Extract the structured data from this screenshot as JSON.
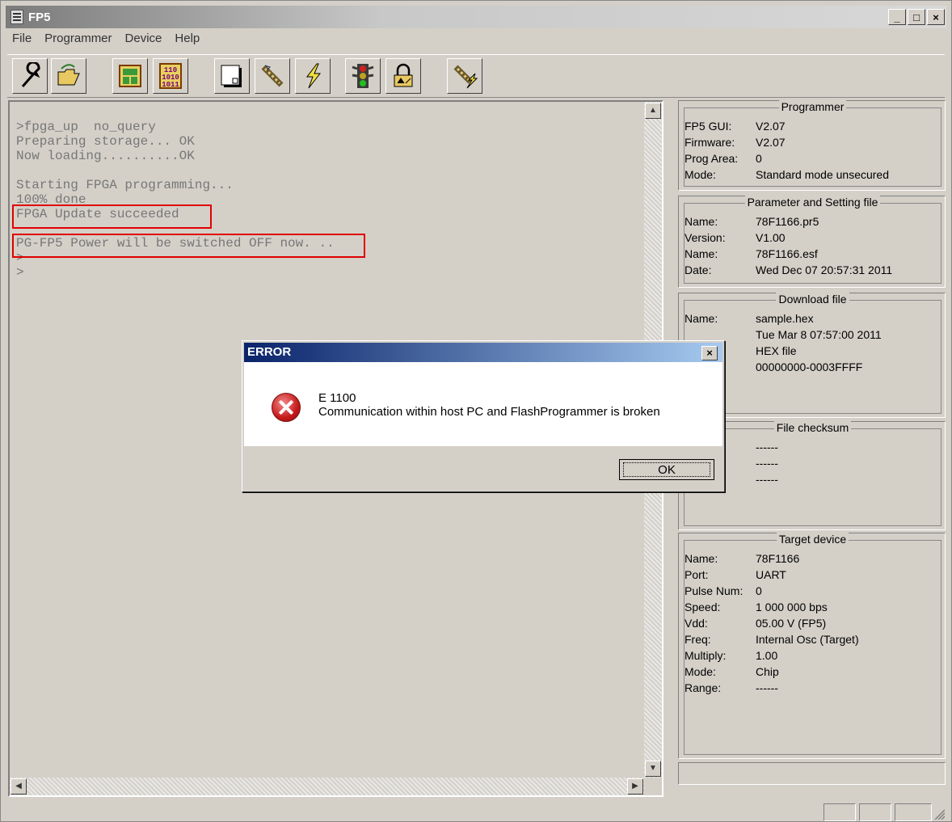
{
  "window": {
    "title": "FP5",
    "minimize": "_",
    "maximize": "□",
    "close": "×"
  },
  "menu": [
    "File",
    "Programmer",
    "Device",
    "Help"
  ],
  "toolbar": [
    "wrench-icon",
    "open-folder-icon",
    "blank-device-icon",
    "hex-data-icon",
    "file-page-icon",
    "erase-probe-icon",
    "lightning-icon",
    "traffic-light-icon",
    "lock-icon",
    "autoprocedure-icon"
  ],
  "console": {
    "lines": [
      ">fpga_up  no_query",
      "Preparing storage... OK",
      "Now loading..........OK",
      "",
      "Starting FPGA programming...",
      "100% done",
      "FPGA Update succeeded",
      "",
      "PG-FP5 Power will be switched OFF now. ..",
      ">",
      ">"
    ]
  },
  "programmer": {
    "title": "Programmer",
    "rows": [
      [
        "FP5 GUI:",
        "V2.07"
      ],
      [
        "Firmware:",
        "V2.07"
      ],
      [
        "Prog Area:",
        "0"
      ],
      [
        "Mode:",
        "Standard mode unsecured"
      ]
    ]
  },
  "parameter": {
    "title": "Parameter and Setting file",
    "rows": [
      [
        "Name:",
        "78F1166.pr5"
      ],
      [
        "Version:",
        "V1.00"
      ],
      [
        "Name:",
        "78F1166.esf"
      ],
      [
        "Date:",
        "Wed Dec 07 20:57:31 2011"
      ]
    ]
  },
  "download": {
    "title": "Download file",
    "rows": [
      [
        "Name:",
        "sample.hex"
      ],
      [
        "",
        "Tue Mar  8 07:57:00 2011"
      ],
      [
        "",
        "HEX file"
      ],
      [
        "",
        "00000000-0003FFFF"
      ]
    ]
  },
  "checksum": {
    "title": "File checksum",
    "rows": [
      [
        "",
        "------"
      ],
      [
        "",
        "------"
      ],
      [
        "",
        "------"
      ]
    ]
  },
  "target": {
    "title": "Target device",
    "rows": [
      [
        "Name:",
        "78F1166"
      ],
      [
        "Port:",
        "UART"
      ],
      [
        "Pulse Num:",
        "0"
      ],
      [
        "Speed:",
        "1 000 000 bps"
      ],
      [
        "Vdd:",
        "05.00 V (FP5)"
      ],
      [
        "Freq:",
        "Internal Osc (Target)"
      ],
      [
        "Multiply:",
        "1.00"
      ],
      [
        "Mode:",
        "Chip"
      ],
      [
        "Range:",
        "------"
      ]
    ]
  },
  "dialog": {
    "title": "ERROR",
    "close": "×",
    "code": "E 1100",
    "message": "Communication within host PC and FlashProgrammer is broken",
    "ok": "OK"
  },
  "colors": {
    "highlight": "#e00000",
    "dialog_title_bar": "#0a246a"
  }
}
